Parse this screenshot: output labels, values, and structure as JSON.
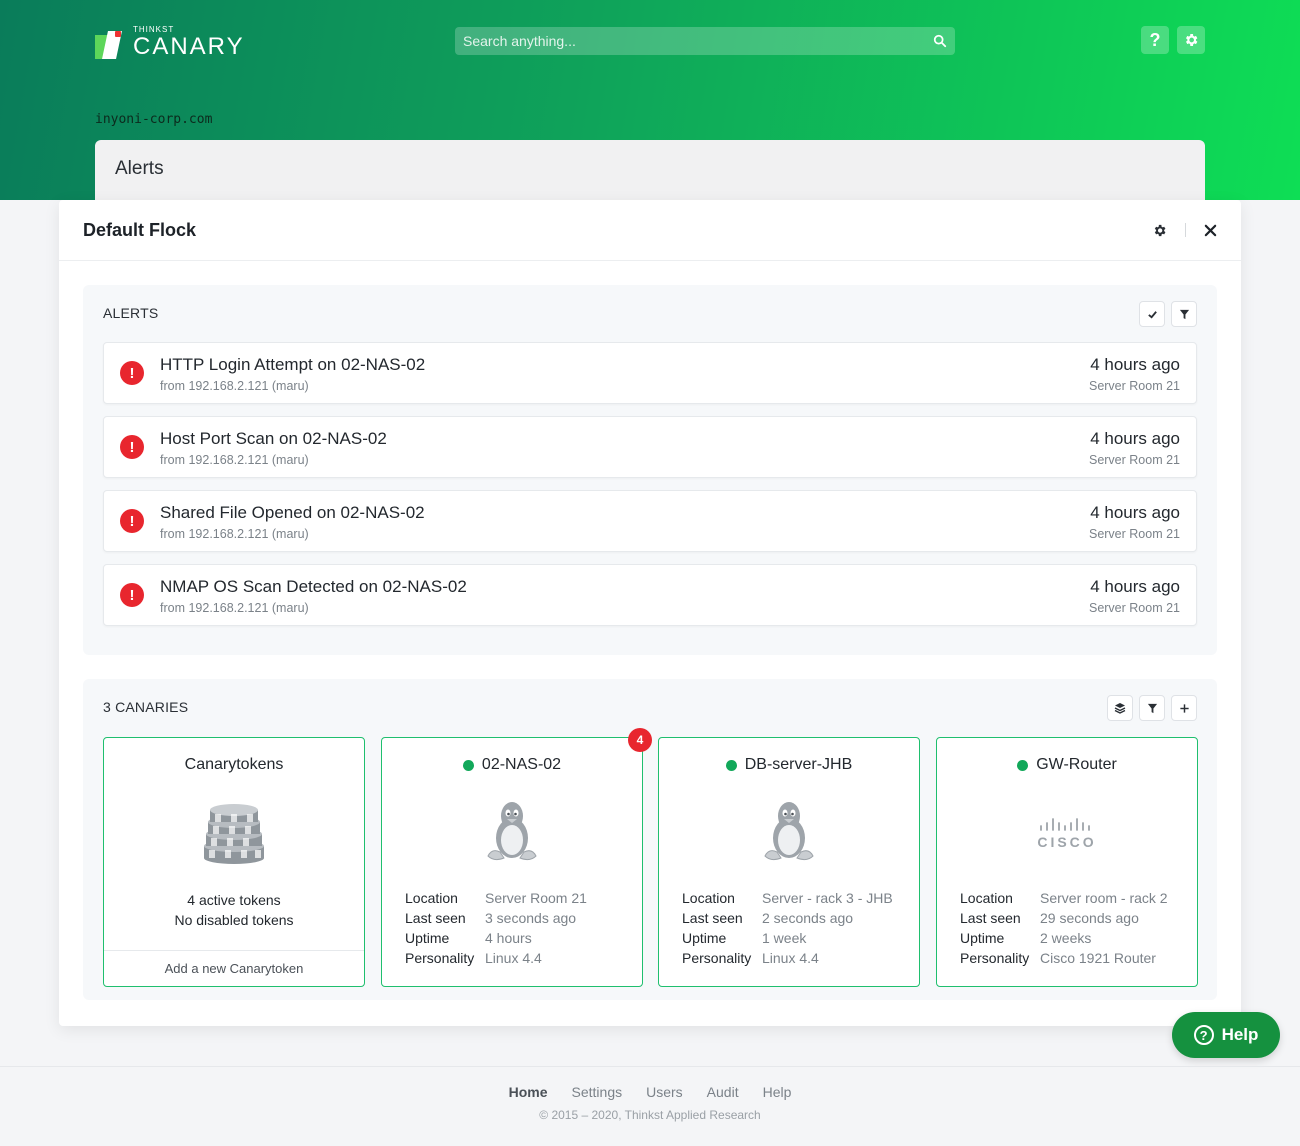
{
  "header": {
    "logo_small": "THINKST",
    "logo_big": "CANARY",
    "search_placeholder": "Search anything...",
    "help_label": "?",
    "domain": "inyoni-corp.com",
    "section_title": "Alerts"
  },
  "modal": {
    "title": "Default Flock",
    "alerts_title": "ALERTS",
    "alerts": [
      {
        "title": "HTTP Login Attempt on 02-NAS-02",
        "source": "from 192.168.2.121 (maru)",
        "time": "4 hours ago",
        "location": "Server Room 21"
      },
      {
        "title": "Host Port Scan on 02-NAS-02",
        "source": "from 192.168.2.121 (maru)",
        "time": "4 hours ago",
        "location": "Server Room 21"
      },
      {
        "title": "Shared File Opened on 02-NAS-02",
        "source": "from 192.168.2.121 (maru)",
        "time": "4 hours ago",
        "location": "Server Room 21"
      },
      {
        "title": "NMAP OS Scan Detected on 02-NAS-02",
        "source": "from 192.168.2.121 (maru)",
        "time": "4 hours ago",
        "location": "Server Room 21"
      }
    ],
    "alert_icon": "!",
    "canaries_title": "3 CANARIES",
    "tokens_card": {
      "title": "Canarytokens",
      "active": "4 active tokens",
      "disabled": "No disabled tokens",
      "add_label": "Add a new Canarytoken"
    },
    "kv_labels": {
      "location": "Location",
      "last_seen": "Last seen",
      "uptime": "Uptime",
      "personality": "Personality"
    },
    "devices": [
      {
        "name": "02-NAS-02",
        "badge": "4",
        "icon": "linux-tux-icon",
        "location": "Server Room 21",
        "last_seen": "3 seconds ago",
        "uptime": "4 hours",
        "personality": "Linux 4.4"
      },
      {
        "name": "DB-server-JHB",
        "icon": "linux-tux-icon",
        "location": "Server - rack 3 - JHB",
        "last_seen": "2 seconds ago",
        "uptime": "1 week",
        "personality": "Linux 4.4"
      },
      {
        "name": "GW-Router",
        "icon": "cisco-logo-icon",
        "cisco_text": "CISCO",
        "location": "Server room - rack 2",
        "last_seen": "29 seconds ago",
        "uptime": "2 weeks",
        "personality": "Cisco 1921 Router"
      }
    ]
  },
  "help_button": {
    "label": "Help",
    "icon_text": "?"
  },
  "footer": {
    "nav": [
      "Home",
      "Settings",
      "Users",
      "Audit",
      "Help"
    ],
    "copyright": "© 2015 – 2020, Thinkst Applied Research"
  },
  "colors": {
    "accent_green": "#15913f",
    "alert_red": "#e8262e",
    "online_green": "#12a85a",
    "card_border": "#1fbf6e"
  }
}
